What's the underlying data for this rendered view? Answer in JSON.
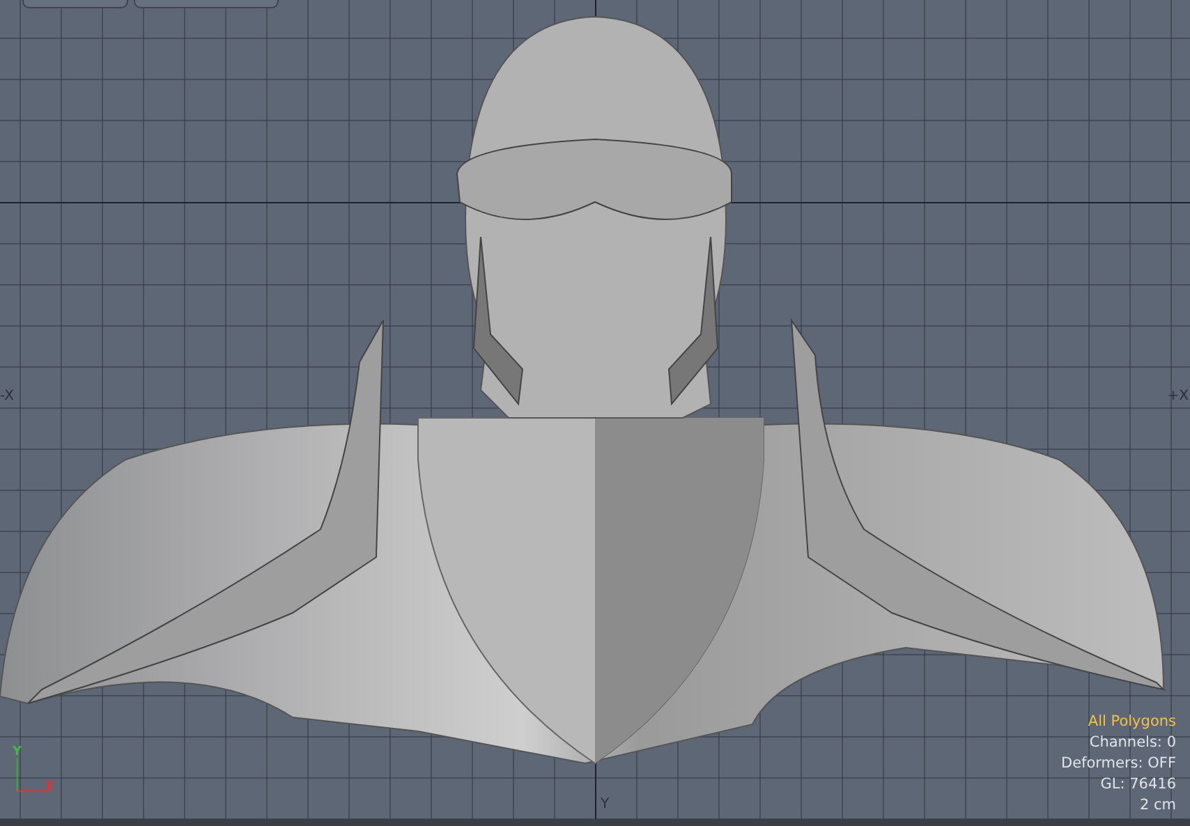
{
  "viewport": {
    "axis_labels": {
      "left": "-X",
      "right": "+X",
      "bottom": "Y"
    },
    "gizmo": {
      "y": "Y",
      "x": "X"
    },
    "info": [
      {
        "text": "All Polygons",
        "highlight": true
      },
      {
        "text": "Channels: 0",
        "highlight": false
      },
      {
        "text": "Deformers: OFF",
        "highlight": false
      },
      {
        "text": "GL: 76416",
        "highlight": false
      },
      {
        "text": "2 cm",
        "highlight": false
      }
    ]
  }
}
